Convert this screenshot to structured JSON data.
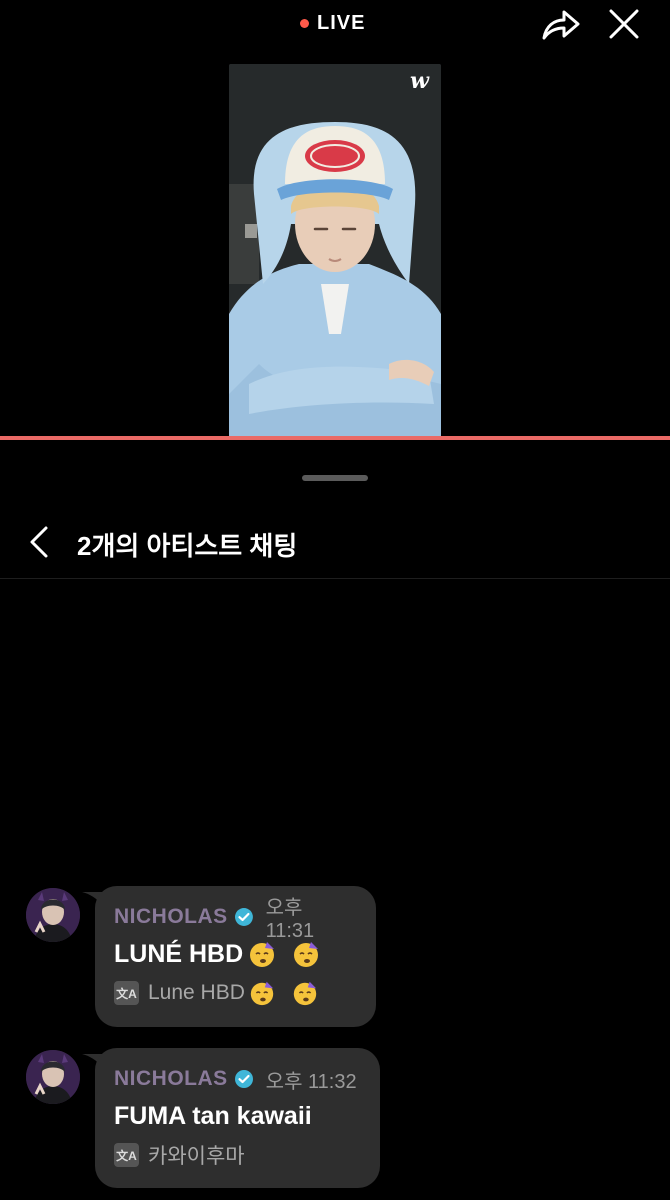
{
  "top": {
    "live_label": "LIVE",
    "live_color": "#ff5a4a",
    "share_icon": "share-arrow-icon",
    "close_icon": "close-icon"
  },
  "video": {
    "logo_text": "w",
    "progress_color": "#ea6a66"
  },
  "chat": {
    "title": "2개의 아티스트 채팅",
    "back_icon": "chevron-left-icon",
    "messages": [
      {
        "author": "NICHOLAS",
        "time": "오후 11:31",
        "text": "LUNÉ HBD",
        "translation": "Lune HBD",
        "emoji": "party-face-emoji"
      },
      {
        "author": "NICHOLAS",
        "time": "오후 11:32",
        "text": "FUMA tan kawaii",
        "translation": "카와이후마"
      }
    ]
  },
  "colors": {
    "background": "#000000",
    "bubble": "#2e2e2e",
    "author": "#8a7a9a",
    "verified": "#3fb6d8"
  }
}
